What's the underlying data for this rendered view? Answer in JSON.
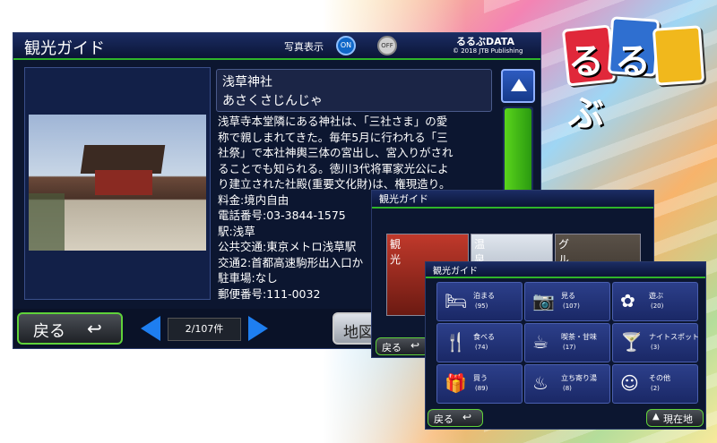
{
  "main": {
    "title": "観光ガイド",
    "photo_label": "写真表示",
    "on_label": "ON",
    "off_label": "OFF",
    "brand": "るるぶDATA",
    "copyright": "© 2018 JTB Publishing",
    "spot_name": "浅草神社",
    "spot_reading": "あさくさじんじゃ",
    "description": [
      "浅草寺本堂隣にある神社は、「三社さま」の愛",
      "称で親しまれてきた。毎年5月に行われる「三",
      "社祭」で本社神輿三体の宮出し、宮入りがされ",
      "ることでも知られる。徳川3代将軍家光公によ",
      "り建立された社殿(重要文化財)は、権現造り。",
      "料金:境内自由",
      "電話番号:03-3844-1575",
      "駅:浅草",
      "公共交通:東京メトロ浅草駅",
      "交通2:首都高速駒形出入口か",
      "駐車場:なし",
      "郵便番号:111-0032"
    ],
    "back_label": "戻る",
    "page_count": "2/107件",
    "map_label": "地図"
  },
  "middle": {
    "title": "観光ガイド",
    "tiles": [
      "観光",
      "温泉",
      "グル"
    ],
    "back_label": "戻る"
  },
  "front": {
    "title": "観光ガイド",
    "categories": [
      {
        "label": "泊まる",
        "count": "(95)",
        "icon": "bed-icon"
      },
      {
        "label": "見る",
        "count": "(107)",
        "icon": "camera-icon"
      },
      {
        "label": "遊ぶ",
        "count": "(20)",
        "icon": "flower-icon"
      },
      {
        "label": "食べる",
        "count": "(74)",
        "icon": "fork-knife-icon"
      },
      {
        "label": "喫茶・甘味",
        "count": "(17)",
        "icon": "cup-icon"
      },
      {
        "label": "ナイトスポット",
        "count": "(3)",
        "icon": "cocktail-icon"
      },
      {
        "label": "買う",
        "count": "(89)",
        "icon": "gift-icon"
      },
      {
        "label": "立ち寄り湯",
        "count": "(8)",
        "icon": "hot-spring-icon"
      },
      {
        "label": "その他",
        "count": "(2)",
        "icon": "smiley-icon"
      }
    ],
    "back_label": "戻る",
    "current_label": "現在地"
  },
  "logo": {
    "text": "るるぶ"
  }
}
